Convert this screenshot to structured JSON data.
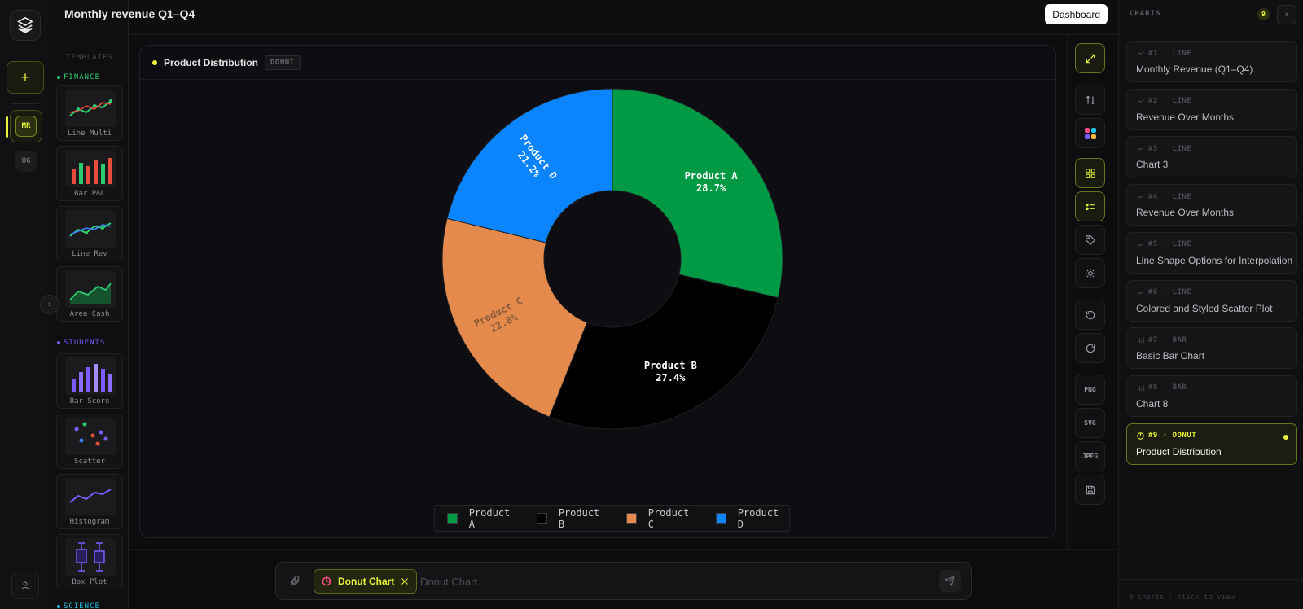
{
  "header": {
    "title": "Monthly revenue Q1–Q4",
    "dashboard_label": "Dashboard"
  },
  "rail": {
    "add_label": "+",
    "items": [
      {
        "label": "MR",
        "active": true
      },
      {
        "label": "UG",
        "active": false
      }
    ],
    "collapse_label": "›"
  },
  "templates": {
    "title": "TEMPLATES",
    "groups": [
      {
        "name": "FINANCE",
        "color": "#2ecc71",
        "items": [
          "Line Multi",
          "Bar P&L",
          "Line Rev",
          "Area Cash"
        ]
      },
      {
        "name": "STUDENTS",
        "color": "#7c5cff",
        "items": [
          "Bar Score",
          "Scatter",
          "Histogram",
          "Box Plot"
        ]
      },
      {
        "name": "SCIENCE",
        "color": "#22c3e6",
        "items": []
      }
    ]
  },
  "panel": {
    "title": "Product Distribution",
    "badge": "DONUT"
  },
  "chart_data": {
    "type": "pie",
    "variant": "donut",
    "title": "Product Distribution",
    "categories": [
      "Product A",
      "Product B",
      "Product C",
      "Product D"
    ],
    "values": [
      28.7,
      27.4,
      22.8,
      21.2
    ],
    "labels": [
      "28.7%",
      "27.4%",
      "22.8%",
      "21.2%"
    ],
    "colors": [
      "#009a45",
      "#000000",
      "#e38a4c",
      "#0a84ff"
    ],
    "label_colors": [
      "#ffffff",
      "#ffffff",
      "#8a5a38",
      "#ffffff"
    ],
    "label_orientation": [
      "horizontal",
      "horizontal",
      "radial",
      "radial"
    ],
    "legend_position": "bottom"
  },
  "tools": {
    "items": [
      {
        "name": "expand-icon",
        "active": true
      },
      {
        "name": "swap-icon",
        "active": false
      },
      {
        "name": "palette-icon",
        "active": false
      },
      {
        "name": "grid-icon",
        "active": true
      },
      {
        "name": "legend-icon",
        "active": true
      },
      {
        "name": "tag-icon",
        "active": false
      },
      {
        "name": "sun-icon",
        "active": false
      },
      {
        "name": "undo-icon",
        "active": false
      },
      {
        "name": "redo-icon",
        "active": false
      }
    ],
    "export": [
      "PNG",
      "SVG",
      "JPEG"
    ]
  },
  "prompt": {
    "chip_label": "Donut Chart",
    "placeholder": "Donut Chart..."
  },
  "charts_panel": {
    "title": "CHARTS",
    "count": "9",
    "next_label": "›",
    "items": [
      {
        "meta": "#1 · LINE",
        "name": "Monthly Revenue (Q1–Q4)",
        "kind": "line",
        "active": false
      },
      {
        "meta": "#2 · LINE",
        "name": "Revenue Over Months",
        "kind": "line",
        "active": false
      },
      {
        "meta": "#3 · LINE",
        "name": "Chart 3",
        "kind": "line",
        "active": false
      },
      {
        "meta": "#4 · LINE",
        "name": "Revenue Over Months",
        "kind": "line",
        "active": false
      },
      {
        "meta": "#5 · LINE",
        "name": "Line Shape Options for Interpolation",
        "kind": "line",
        "active": false
      },
      {
        "meta": "#6 · LINE",
        "name": "Colored and Styled Scatter Plot",
        "kind": "line",
        "active": false
      },
      {
        "meta": "#7 · BAR",
        "name": "Basic Bar Chart",
        "kind": "bar",
        "active": false
      },
      {
        "meta": "#8 · BAR",
        "name": "Chart 8",
        "kind": "bar",
        "active": false
      },
      {
        "meta": "#9 · DONUT",
        "name": "Product Distribution",
        "kind": "donut",
        "active": true
      }
    ],
    "footer": "9 charts · click to view"
  }
}
